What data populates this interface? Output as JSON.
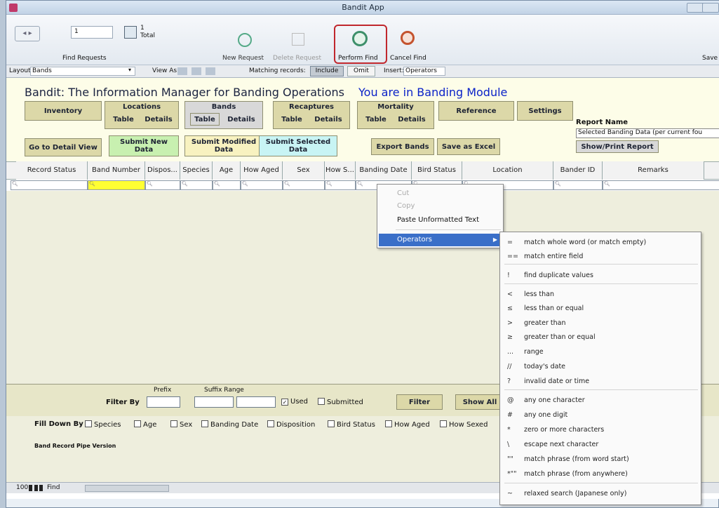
{
  "window": {
    "title": "Bandit App"
  },
  "toolbar": {
    "record_number": "1",
    "total_count": "1",
    "total_label": "Total",
    "find_requests_label": "Find Requests",
    "new_request": "New Request",
    "delete_request": "Delete Request",
    "perform_find": "Perform Find",
    "cancel_find": "Cancel Find",
    "save_label": "Save"
  },
  "layoutbar": {
    "layout_label": "Layout:",
    "layout_value": "Bands",
    "view_as_label": "View As:",
    "matching_label": "Matching records:",
    "include": "Include",
    "omit": "Omit",
    "insert_label": "Insert:",
    "insert_value": "Operators"
  },
  "app": {
    "title": "Bandit: The Information Manager for Banding Operations",
    "module": "You are in Banding Module"
  },
  "nav": {
    "inventory": "Inventory",
    "locations": "Locations",
    "bands": "Bands",
    "recaptures": "Recaptures",
    "mortality": "Mortality",
    "reference": "Reference",
    "settings": "Settings",
    "table": "Table",
    "details": "Details"
  },
  "actions": {
    "go_detail": "Go to Detail View",
    "submit_new": "Submit New Data",
    "submit_modified": "Submit Modified Data",
    "submit_selected": "Submit Selected Data",
    "export_bands": "Export Bands",
    "save_excel": "Save as Excel",
    "report_name_label": "Report Name",
    "report_name_value": "Selected Banding Data (per current fou",
    "show_print": "Show/Print Report"
  },
  "columns": [
    "Record Status",
    "Band Number",
    "Dispos...",
    "Species",
    "Age",
    "How Aged",
    "Sex",
    "How S...",
    "Banding Date",
    "Bird Status",
    "Location",
    "Bander ID",
    "Remarks"
  ],
  "context_menu": {
    "cut": "Cut",
    "copy": "Copy",
    "paste": "Paste Unformatted Text",
    "operators": "Operators"
  },
  "operators": [
    {
      "sym": "=",
      "label": "match whole word (or match empty)"
    },
    {
      "sym": "==",
      "label": "match entire field"
    },
    {
      "sym": "!",
      "label": "find duplicate values"
    },
    {
      "sym": "<",
      "label": "less than"
    },
    {
      "sym": "≤",
      "label": "less than or equal"
    },
    {
      "sym": ">",
      "label": "greater than"
    },
    {
      "sym": "≥",
      "label": "greater than or equal"
    },
    {
      "sym": "...",
      "label": "range"
    },
    {
      "sym": "//",
      "label": "today's date"
    },
    {
      "sym": "?",
      "label": "invalid date or time"
    },
    {
      "sym": "@",
      "label": "any one character"
    },
    {
      "sym": "#",
      "label": "any one digit"
    },
    {
      "sym": "*",
      "label": "zero or more characters"
    },
    {
      "sym": "\\",
      "label": "escape next character"
    },
    {
      "sym": "\"\"",
      "label": "match phrase (from word start)"
    },
    {
      "sym": "*\"\"",
      "label": "match phrase (from anywhere)"
    },
    {
      "sym": "~",
      "label": "relaxed search (Japanese only)"
    }
  ],
  "filter": {
    "filter_by": "Filter By",
    "prefix": "Prefix",
    "suffix_range": "Suffix Range",
    "used": "Used",
    "submitted": "Submitted",
    "filter_btn": "Filter",
    "show_all": "Show All"
  },
  "filldown": {
    "label": "Fill Down By",
    "options": [
      "Species",
      "Age",
      "Sex",
      "Banding Date",
      "Disposition",
      "Bird Status",
      "How Aged",
      "How Sexed"
    ],
    "version": "Band Record Pipe Version"
  },
  "statusbar": {
    "zoom": "100",
    "mode": "Find"
  }
}
